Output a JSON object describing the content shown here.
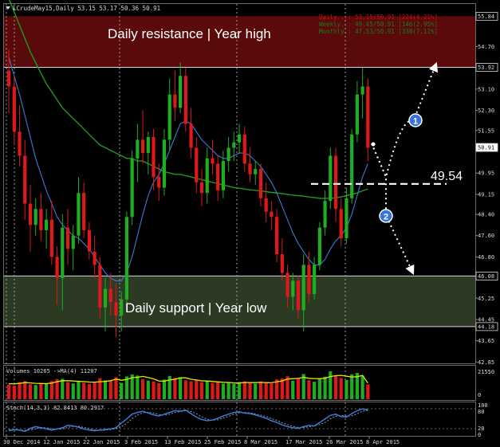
{
  "header": {
    "title": "LCrudeMay15,Daily  53.15 53.17 50.36 50.91"
  },
  "info_panel": [
    {
      "label": "Daily...: 53.15/50.91 [224(4.21%]",
      "color": "#d01010"
    },
    {
      "label": "Weekly..: 49.45/50.91 [146(2.95%]",
      "color": "#1e7a1e"
    },
    {
      "label": "Monthly.: 47.53/50.91 [338(7.11%]",
      "color": "#1e7a1e"
    }
  ],
  "zones": {
    "resistance": {
      "label": "Daily resistance | Year high",
      "top": 55.84,
      "bottom": 53.92,
      "color": "#5a0a0a"
    },
    "support": {
      "label": "Daily support | Year low",
      "top": 46.08,
      "bottom": 44.18,
      "color": "#2c3a24"
    }
  },
  "annotations": {
    "pivot_label": "49.54",
    "pivot_value": 49.54,
    "scenario1": "1",
    "scenario2": "2"
  },
  "volume_panel": {
    "title": "Volumes 10265  ->MA(4) 11207",
    "scale_top": "21550",
    "scale_bottom": "0"
  },
  "stoch_panel": {
    "title": "Stoch(14,3,3) 82.8413 80.2917",
    "scale_top": "100",
    "scale_80": "80",
    "scale_20": "20",
    "scale_bottom": "0"
  },
  "chart_data": {
    "type": "candlestick",
    "ylim": [
      42.8,
      56.3
    ],
    "price_ticks": [
      "55.84",
      "54.70",
      "53.92",
      "53.10",
      "52.30",
      "51.55",
      "50.91",
      "49.95",
      "49.15",
      "48.40",
      "47.60",
      "46.80",
      "46.08",
      "45.25",
      "44.45",
      "44.18",
      "43.65",
      "42.85"
    ],
    "current_price": 50.91,
    "x_labels": [
      "30 Dec 2014",
      "12 Jan 2015",
      "22 Jan 2015",
      "3 Feb 2015",
      "13 Feb 2015",
      "25 Feb 2015",
      "8 Mar 2015",
      "17 Mar 2015",
      "26 Mar 2015",
      "8 Apr 2015"
    ],
    "candles": [
      [
        53.8,
        54.6,
        52.2,
        53.2
      ],
      [
        53.2,
        53.6,
        51.0,
        51.5
      ],
      [
        51.5,
        52.5,
        50.2,
        50.6
      ],
      [
        50.6,
        51.2,
        48.2,
        48.8
      ],
      [
        48.8,
        49.5,
        47.0,
        48.0
      ],
      [
        48.0,
        49.0,
        47.6,
        48.6
      ],
      [
        48.6,
        49.2,
        47.4,
        47.8
      ],
      [
        47.8,
        48.6,
        47.1,
        48.2
      ],
      [
        48.2,
        48.9,
        46.5,
        46.8
      ],
      [
        46.8,
        47.2,
        45.0,
        46.0
      ],
      [
        46.0,
        48.4,
        44.8,
        47.9
      ],
      [
        47.9,
        48.6,
        46.5,
        47.1
      ],
      [
        47.1,
        48.0,
        46.3,
        47.6
      ],
      [
        47.6,
        49.8,
        47.3,
        49.2
      ],
      [
        49.2,
        49.6,
        47.5,
        47.8
      ],
      [
        47.8,
        48.1,
        46.7,
        47.0
      ],
      [
        47.0,
        47.6,
        46.0,
        46.5
      ],
      [
        46.5,
        46.8,
        44.5,
        44.9
      ],
      [
        44.9,
        46.0,
        44.0,
        45.6
      ],
      [
        45.6,
        46.2,
        44.6,
        45.1
      ],
      [
        45.1,
        45.8,
        43.8,
        44.6
      ],
      [
        44.6,
        45.5,
        44.0,
        45.2
      ],
      [
        45.2,
        48.5,
        45.0,
        48.3
      ],
      [
        48.3,
        50.8,
        48.0,
        50.5
      ],
      [
        50.5,
        51.8,
        49.6,
        51.2
      ],
      [
        51.2,
        52.3,
        50.3,
        50.7
      ],
      [
        50.7,
        51.5,
        49.9,
        51.3
      ],
      [
        51.3,
        51.6,
        49.3,
        49.8
      ],
      [
        49.8,
        50.3,
        48.9,
        49.4
      ],
      [
        49.4,
        51.6,
        49.1,
        51.2
      ],
      [
        51.2,
        53.5,
        50.8,
        52.9
      ],
      [
        52.9,
        53.8,
        51.9,
        52.4
      ],
      [
        52.4,
        54.1,
        52.2,
        53.6
      ],
      [
        53.6,
        53.9,
        51.5,
        51.8
      ],
      [
        51.8,
        52.4,
        50.5,
        50.9
      ],
      [
        50.9,
        51.3,
        49.2,
        49.6
      ],
      [
        49.6,
        50.1,
        48.7,
        49.2
      ],
      [
        49.2,
        50.9,
        48.8,
        50.5
      ],
      [
        50.5,
        51.2,
        49.9,
        50.3
      ],
      [
        50.3,
        50.6,
        48.9,
        49.3
      ],
      [
        49.3,
        50.8,
        49.0,
        50.4
      ],
      [
        50.4,
        51.3,
        50.0,
        50.9
      ],
      [
        50.9,
        51.5,
        50.4,
        51.1
      ],
      [
        51.1,
        51.8,
        50.7,
        51.4
      ],
      [
        51.4,
        51.7,
        50.0,
        50.3
      ],
      [
        50.3,
        50.9,
        49.6,
        49.9
      ],
      [
        49.9,
        50.4,
        49.5,
        50.1
      ],
      [
        50.1,
        50.3,
        48.7,
        49.0
      ],
      [
        49.0,
        49.6,
        48.1,
        48.5
      ],
      [
        48.5,
        48.9,
        47.8,
        48.3
      ],
      [
        48.3,
        48.6,
        46.6,
        46.9
      ],
      [
        46.9,
        47.5,
        45.9,
        46.2
      ],
      [
        46.2,
        46.5,
        44.9,
        45.3
      ],
      [
        45.3,
        46.2,
        44.8,
        45.9
      ],
      [
        45.9,
        46.1,
        44.5,
        44.8
      ],
      [
        44.8,
        46.9,
        44.0,
        46.5
      ],
      [
        46.5,
        47.0,
        45.1,
        45.4
      ],
      [
        45.4,
        46.8,
        45.2,
        46.5
      ],
      [
        46.5,
        48.1,
        46.3,
        47.9
      ],
      [
        47.9,
        49.3,
        47.6,
        48.9
      ],
      [
        48.9,
        50.9,
        48.6,
        50.6
      ],
      [
        50.6,
        50.9,
        48.1,
        48.6
      ],
      [
        48.6,
        49.0,
        47.2,
        47.5
      ],
      [
        47.5,
        49.4,
        47.3,
        49.0
      ],
      [
        49.0,
        51.6,
        48.8,
        51.4
      ],
      [
        51.4,
        53.4,
        51.1,
        52.9
      ],
      [
        52.9,
        53.9,
        52.0,
        53.2
      ],
      [
        53.2,
        53.5,
        50.4,
        50.9
      ]
    ],
    "ma_fast": [
      54.3,
      53.6,
      52.9,
      52.1,
      51.3,
      50.5,
      49.9,
      49.3,
      48.8,
      48.3,
      48.0,
      47.8,
      47.6,
      47.5,
      47.3,
      47.1,
      46.8,
      46.5,
      46.2,
      46.0,
      45.9,
      45.9,
      46.2,
      46.8,
      47.6,
      48.4,
      49.1,
      49.6,
      49.9,
      50.3,
      50.8,
      51.3,
      51.8,
      51.9,
      51.8,
      51.5,
      51.2,
      51.0,
      50.8,
      50.6,
      50.5,
      50.5,
      50.6,
      50.7,
      50.7,
      50.6,
      50.4,
      50.2,
      49.9,
      49.6,
      49.2,
      48.7,
      48.2,
      47.7,
      47.3,
      47.0,
      46.7,
      46.5,
      46.5,
      46.7,
      47.1,
      47.4,
      47.6,
      47.9,
      48.4,
      49.1,
      49.8,
      50.3
    ],
    "ma_slow": [
      56.5,
      56.0,
      55.5,
      55.0,
      54.5,
      54.1,
      53.7,
      53.3,
      53.0,
      52.7,
      52.4,
      52.2,
      52.0,
      51.8,
      51.6,
      51.4,
      51.2,
      51.0,
      50.9,
      50.8,
      50.7,
      50.6,
      50.5,
      50.5,
      50.4,
      50.4,
      50.3,
      50.2,
      50.1,
      50.0,
      49.95,
      49.9,
      49.9,
      49.85,
      49.8,
      49.75,
      49.7,
      49.65,
      49.6,
      49.55,
      49.5,
      49.45,
      49.4,
      49.38,
      49.35,
      49.32,
      49.3,
      49.28,
      49.25,
      49.22,
      49.2,
      49.18,
      49.15,
      49.12,
      49.1,
      49.08,
      49.05,
      49.03,
      49.0,
      49.0,
      49.0,
      49.02,
      49.05,
      49.1,
      49.15,
      49.2,
      49.28,
      49.35
    ],
    "volume": [
      10200,
      9400,
      11800,
      12500,
      10400,
      9800,
      11200,
      10800,
      12600,
      13900,
      14100,
      11800,
      10900,
      12800,
      11400,
      10600,
      11900,
      14600,
      13100,
      12700,
      15300,
      11300,
      15800,
      17200,
      16400,
      13800,
      12900,
      12300,
      11200,
      13600,
      16100,
      14700,
      15200,
      13100,
      12400,
      13600,
      11800,
      12700,
      11300,
      12100,
      10800,
      11600,
      10700,
      11900,
      12300,
      11100,
      10800,
      12400,
      11600,
      10900,
      13700,
      14300,
      15900,
      12800,
      14700,
      17400,
      13200,
      12100,
      14100,
      15600,
      19300,
      16200,
      14700,
      13400,
      17200,
      18200,
      16400,
      10265
    ],
    "volume_ma": [
      10800,
      10600,
      11000,
      11500,
      11300,
      11000,
      10900,
      10800,
      11200,
      12100,
      12800,
      12800,
      12600,
      12400,
      12200,
      11900,
      11800,
      12100,
      12400,
      12800,
      13900,
      13100,
      13700,
      14900,
      15200,
      15800,
      15100,
      14100,
      12600,
      12500,
      13300,
      13800,
      14800,
      14800,
      13800,
      13300,
      12700,
      12600,
      12300,
      12000,
      11700,
      11600,
      11300,
      11200,
      11600,
      11500,
      11500,
      11600,
      11500,
      11400,
      12100,
      12600,
      14000,
      14200,
      14400,
      15200,
      14500,
      14300,
      14200,
      14600,
      15700,
      16300,
      16500,
      15900,
      15400,
      15600,
      16500,
      11207
    ],
    "stoch_k": [
      12,
      16,
      14,
      10,
      20,
      26,
      22,
      18,
      14,
      18,
      22,
      30,
      28,
      24,
      18,
      14,
      12,
      14,
      16,
      18,
      22,
      38,
      52,
      68,
      74,
      78,
      72,
      66,
      62,
      68,
      74,
      80,
      78,
      82,
      70,
      58,
      50,
      46,
      48,
      54,
      62,
      68,
      74,
      76,
      72,
      70,
      66,
      60,
      54,
      46,
      40,
      32,
      26,
      22,
      20,
      26,
      30,
      28,
      40,
      52,
      64,
      68,
      60,
      58,
      70,
      80,
      86,
      82.8
    ],
    "stoch_d": [
      16,
      15,
      14,
      13,
      15,
      19,
      23,
      22,
      18,
      17,
      18,
      23,
      27,
      27,
      23,
      19,
      15,
      13,
      14,
      16,
      19,
      26,
      37,
      53,
      65,
      73,
      75,
      72,
      67,
      65,
      68,
      74,
      77,
      80,
      77,
      70,
      59,
      51,
      48,
      49,
      55,
      61,
      68,
      73,
      74,
      73,
      69,
      65,
      60,
      53,
      47,
      39,
      33,
      27,
      23,
      23,
      25,
      28,
      33,
      40,
      52,
      61,
      64,
      62,
      63,
      69,
      79,
      80.3
    ],
    "series": [
      {
        "name": "Volumes"
      },
      {
        "name": "MA(4)"
      },
      {
        "name": "Stoch(14,3,3)"
      }
    ]
  }
}
